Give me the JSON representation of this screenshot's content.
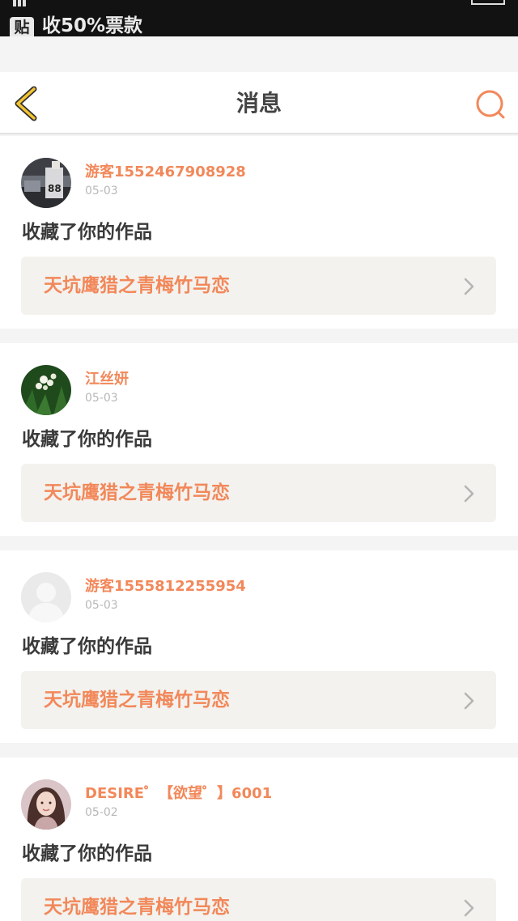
{
  "status_bar": {
    "notification_icon_text": "贴",
    "notification_text": "收50%票款"
  },
  "nav": {
    "title": "消息",
    "back_icon": "chevron-left-icon",
    "search_icon": "search-icon"
  },
  "colors": {
    "accent": "#f2885a",
    "back_icon": "#f4c430",
    "link_background": "#f3f2ee",
    "page_background": "#f4f4f4"
  },
  "messages": [
    {
      "username": "游客1552467908928",
      "date": "05-03",
      "action": "收藏了你的作品",
      "work_title": "天坑鹰猎之青梅竹马恋",
      "avatar": "photo-avatar"
    },
    {
      "username": "江丝妍",
      "date": "05-03",
      "action": "收藏了你的作品",
      "work_title": "天坑鹰猎之青梅竹马恋",
      "avatar": "flower-avatar"
    },
    {
      "username": "游客1555812255954",
      "date": "05-03",
      "action": "收藏了你的作品",
      "work_title": "天坑鹰猎之青梅竹马恋",
      "avatar": "default-avatar"
    },
    {
      "username": "DESIRE゜【欲望゜】6001",
      "date": "05-02",
      "action": "收藏了你的作品",
      "work_title": "天坑鹰猎之青梅竹马恋",
      "avatar": "portrait-avatar"
    }
  ]
}
